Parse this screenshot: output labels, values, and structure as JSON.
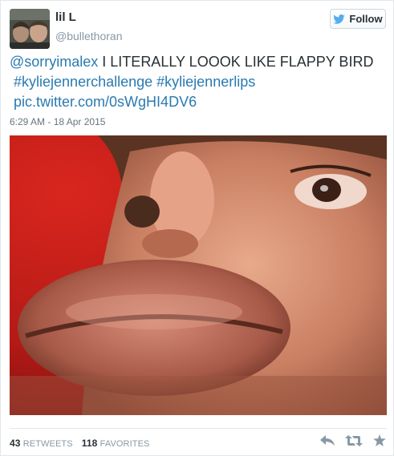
{
  "user": {
    "display_name": "lil L",
    "handle": "@bullethoran"
  },
  "follow_button": {
    "label": "Follow",
    "icon": "twitter-bird-icon"
  },
  "tweet": {
    "mention": "@sorryimalex",
    "text": " I LITERALLY LOOOK LIKE FLAPPY BIRD",
    "hashtag_1": "#kyliejennerchallenge",
    "hashtag_2": "#kyliejennerlips",
    "link": "pic.twitter.com/0sWgHI4DV6",
    "timestamp": "6:29 AM - 18 Apr 2015"
  },
  "stats": {
    "retweets_count": "43",
    "retweets_label": "RETWEETS",
    "favorites_count": "118",
    "favorites_label": "FAVORITES"
  },
  "actions": {
    "reply_icon": "reply-icon",
    "retweet_icon": "retweet-icon",
    "favorite_icon": "star-icon"
  },
  "colors": {
    "link": "#2a7ab0",
    "muted": "#8899a6",
    "text": "#292f33",
    "twitter_blue": "#55acee",
    "photo_background": "#c8201b"
  }
}
